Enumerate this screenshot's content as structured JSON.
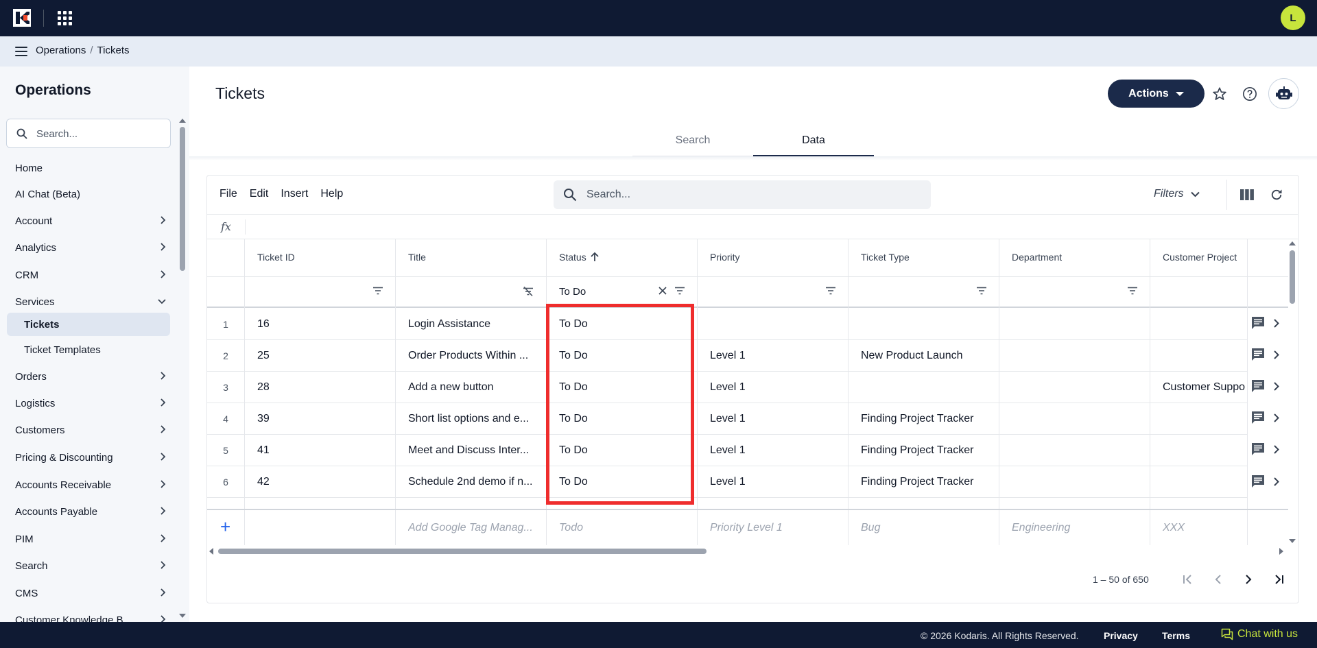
{
  "topbar": {
    "avatar_initial": "L"
  },
  "breadcrumb": {
    "root": "Operations",
    "separator": "/",
    "current": "Tickets"
  },
  "sidebar": {
    "title": "Operations",
    "search_placeholder": "Search...",
    "items": [
      {
        "label": "Home",
        "expandable": false
      },
      {
        "label": "AI Chat (Beta)",
        "expandable": false
      },
      {
        "label": "Account",
        "expandable": true
      },
      {
        "label": "Analytics",
        "expandable": true
      },
      {
        "label": "CRM",
        "expandable": true
      },
      {
        "label": "Services",
        "expandable": true,
        "expanded": true
      },
      {
        "label": "Orders",
        "expandable": true
      },
      {
        "label": "Logistics",
        "expandable": true
      },
      {
        "label": "Customers",
        "expandable": true
      },
      {
        "label": "Pricing & Discounting",
        "expandable": true
      },
      {
        "label": "Accounts Receivable",
        "expandable": true
      },
      {
        "label": "Accounts Payable",
        "expandable": true
      },
      {
        "label": "PIM",
        "expandable": true
      },
      {
        "label": "Search",
        "expandable": true
      },
      {
        "label": "CMS",
        "expandable": true
      },
      {
        "label": "Customer Knowledge B...",
        "expandable": true
      }
    ],
    "services_children": [
      {
        "label": "Tickets",
        "active": true
      },
      {
        "label": "Ticket Templates",
        "active": false
      }
    ]
  },
  "page": {
    "title": "Tickets",
    "actions_label": "Actions",
    "tabs": [
      {
        "label": "Search",
        "active": false
      },
      {
        "label": "Data",
        "active": true
      }
    ]
  },
  "grid": {
    "menu": [
      "File",
      "Edit",
      "Insert",
      "Help"
    ],
    "search_placeholder": "Search...",
    "filters_label": "Filters",
    "fx_label": "fx",
    "columns": [
      {
        "label": "Ticket ID",
        "filter": ""
      },
      {
        "label": "Title",
        "filter": ""
      },
      {
        "label": "Status",
        "filter": "To Do",
        "sorted": "asc"
      },
      {
        "label": "Priority",
        "filter": ""
      },
      {
        "label": "Ticket Type",
        "filter": ""
      },
      {
        "label": "Department",
        "filter": ""
      },
      {
        "label": "Customer Project",
        "filter": ""
      }
    ],
    "rows": [
      {
        "n": "1",
        "id": "16",
        "title": "Login Assistance",
        "status": "To Do",
        "priority": "",
        "type": "",
        "department": "",
        "project": ""
      },
      {
        "n": "2",
        "id": "25",
        "title": "Order Products Within ...",
        "status": "To Do",
        "priority": "Level 1",
        "type": "New Product Launch",
        "department": "",
        "project": ""
      },
      {
        "n": "3",
        "id": "28",
        "title": "Add a new button",
        "status": "To Do",
        "priority": "Level 1",
        "type": "",
        "department": "",
        "project": "Customer Suppo"
      },
      {
        "n": "4",
        "id": "39",
        "title": "Short list options and e...",
        "status": "To Do",
        "priority": "Level 1",
        "type": "Finding Project Tracker",
        "department": "",
        "project": ""
      },
      {
        "n": "5",
        "id": "41",
        "title": "Meet and Discuss Inter...",
        "status": "To Do",
        "priority": "Level 1",
        "type": "Finding Project Tracker",
        "department": "",
        "project": ""
      },
      {
        "n": "6",
        "id": "42",
        "title": "Schedule 2nd demo if n...",
        "status": "To Do",
        "priority": "Level 1",
        "type": "Finding Project Tracker",
        "department": "",
        "project": ""
      }
    ],
    "new_row_placeholders": {
      "title": "Add Google Tag Manag...",
      "status": "Todo",
      "priority": "Priority Level 1",
      "type": "Bug",
      "department": "Engineering",
      "project": "XXX"
    },
    "pagination": "1 – 50 of 650"
  },
  "footer": {
    "copyright": "© 2026 Kodaris. All Rights Reserved.",
    "privacy": "Privacy",
    "terms": "Terms",
    "chat": "Chat with us"
  },
  "colors": {
    "navy": "#0f1a33",
    "accent": "#c7e43c",
    "highlight": "#ef2d2d",
    "button": "#1b2a4a"
  }
}
